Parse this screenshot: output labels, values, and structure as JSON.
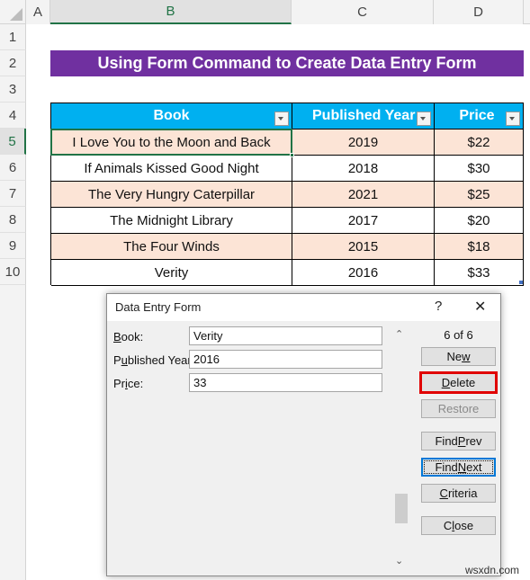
{
  "sheet": {
    "columns": [
      "A",
      "B",
      "C",
      "D"
    ],
    "rows": [
      "1",
      "2",
      "3",
      "4",
      "5",
      "6",
      "7",
      "8",
      "9",
      "10"
    ],
    "title": "Using Form Command to Create Data Entry Form",
    "table": {
      "headers": [
        "Book",
        "Published Year",
        "Price"
      ],
      "rows": [
        [
          "I Love You to the Moon and Back",
          "2019",
          "$22"
        ],
        [
          "If Animals Kissed Good Night",
          "2018",
          "$30"
        ],
        [
          "The Very Hungry Caterpillar",
          "2021",
          "$25"
        ],
        [
          "The Midnight Library",
          "2017",
          "$20"
        ],
        [
          "The Four Winds",
          "2015",
          "$18"
        ],
        [
          "Verity",
          "2016",
          "$33"
        ]
      ]
    },
    "colors": {
      "title_bg": "#7030a0",
      "header_bg": "#00b0f0",
      "band_bg": "#fce4d6",
      "selection": "#217346"
    }
  },
  "dialog": {
    "title": "Data Entry Form",
    "help": "?",
    "close": "✕",
    "record_counter": "6 of 6",
    "fields": [
      {
        "label_pre": "",
        "label_key": "B",
        "label_post": "ook:",
        "value": "Verity"
      },
      {
        "label_pre": "P",
        "label_key": "u",
        "label_post": "blished Year:",
        "value": "2016"
      },
      {
        "label_pre": "Pr",
        "label_key": "i",
        "label_post": "ce:",
        "value": "33"
      }
    ],
    "buttons": {
      "new": {
        "pre": "Ne",
        "key": "w",
        "post": ""
      },
      "delete": {
        "pre": "",
        "key": "D",
        "post": "elete"
      },
      "restore": {
        "pre": "",
        "key": "",
        "post": "Restore"
      },
      "find_prev": {
        "pre": "Find ",
        "key": "P",
        "post": "rev"
      },
      "find_next": {
        "pre": "Find ",
        "key": "N",
        "post": "ext"
      },
      "criteria": {
        "pre": "",
        "key": "C",
        "post": "riteria"
      },
      "close": {
        "pre": "C",
        "key": "l",
        "post": "ose"
      }
    },
    "highlight_color": "#e00000"
  },
  "watermark": "wsxdn.com"
}
